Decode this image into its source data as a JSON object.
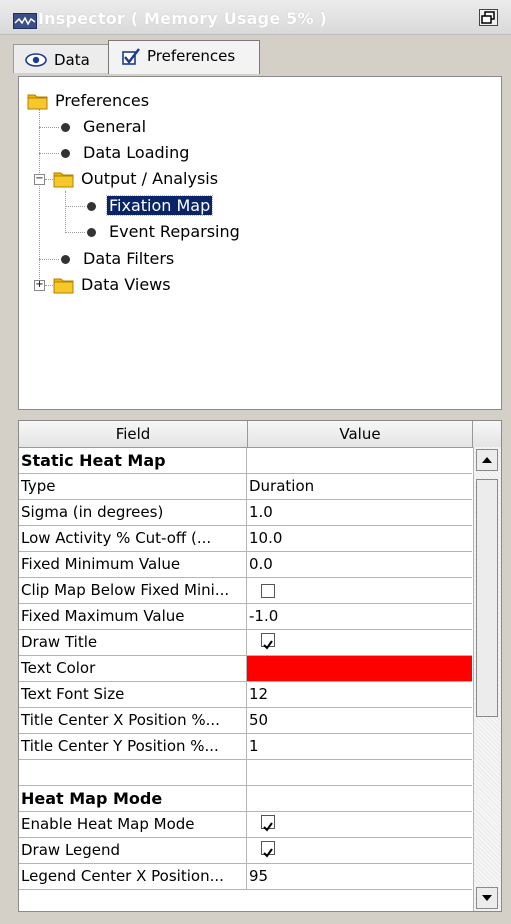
{
  "window": {
    "title": "Inspector ( Memory Usage 5% )",
    "logo_icon": "eye-trace-logo-icon",
    "restore_icon": "restore-window-icon"
  },
  "tabs": [
    {
      "label": "Data",
      "icon": "eye-icon",
      "active": false
    },
    {
      "label": "Preferences",
      "icon": "checkmark-icon",
      "active": true
    }
  ],
  "tree": {
    "root": "Preferences",
    "items": {
      "general": "General",
      "data_loading": "Data Loading",
      "output_analysis": "Output / Analysis",
      "fixation_map": "Fixation Map",
      "event_reparsing": "Event Reparsing",
      "data_filters": "Data Filters",
      "data_views": "Data Views"
    },
    "selected": "Fixation Map"
  },
  "grid": {
    "columns": {
      "field": "Field",
      "value": "Value"
    },
    "rows": [
      {
        "field": "Static Heat Map",
        "value": "",
        "section": true
      },
      {
        "field": "Type",
        "value": "Duration"
      },
      {
        "field": "Sigma (in degrees)",
        "value": "1.0"
      },
      {
        "field": "Low Activity % Cut-off (...",
        "value": "10.0"
      },
      {
        "field": "Fixed Minimum Value",
        "value": "0.0"
      },
      {
        "field": "Clip Map Below Fixed Mini...",
        "value": "",
        "checkbox": false
      },
      {
        "field": "Fixed Maximum Value",
        "value": "-1.0"
      },
      {
        "field": "Draw Title",
        "value": "",
        "checkbox": true
      },
      {
        "field": "Text Color",
        "value": "",
        "color": "#ff0000"
      },
      {
        "field": "Text Font Size",
        "value": "12"
      },
      {
        "field": "Title Center X Position %...",
        "value": "50"
      },
      {
        "field": "Title Center Y Position %...",
        "value": "1"
      },
      {
        "field": "",
        "value": ""
      },
      {
        "field": "Heat Map Mode",
        "value": "",
        "section": true
      },
      {
        "field": "Enable Heat Map Mode",
        "value": "",
        "checkbox": true
      },
      {
        "field": "Draw Legend",
        "value": "",
        "checkbox": true
      },
      {
        "field": "Legend Center X Position...",
        "value": "95"
      }
    ]
  },
  "colors": {
    "selection": "#0a246a",
    "text_color_value": "#ff0000",
    "folder": "#f0b400"
  }
}
